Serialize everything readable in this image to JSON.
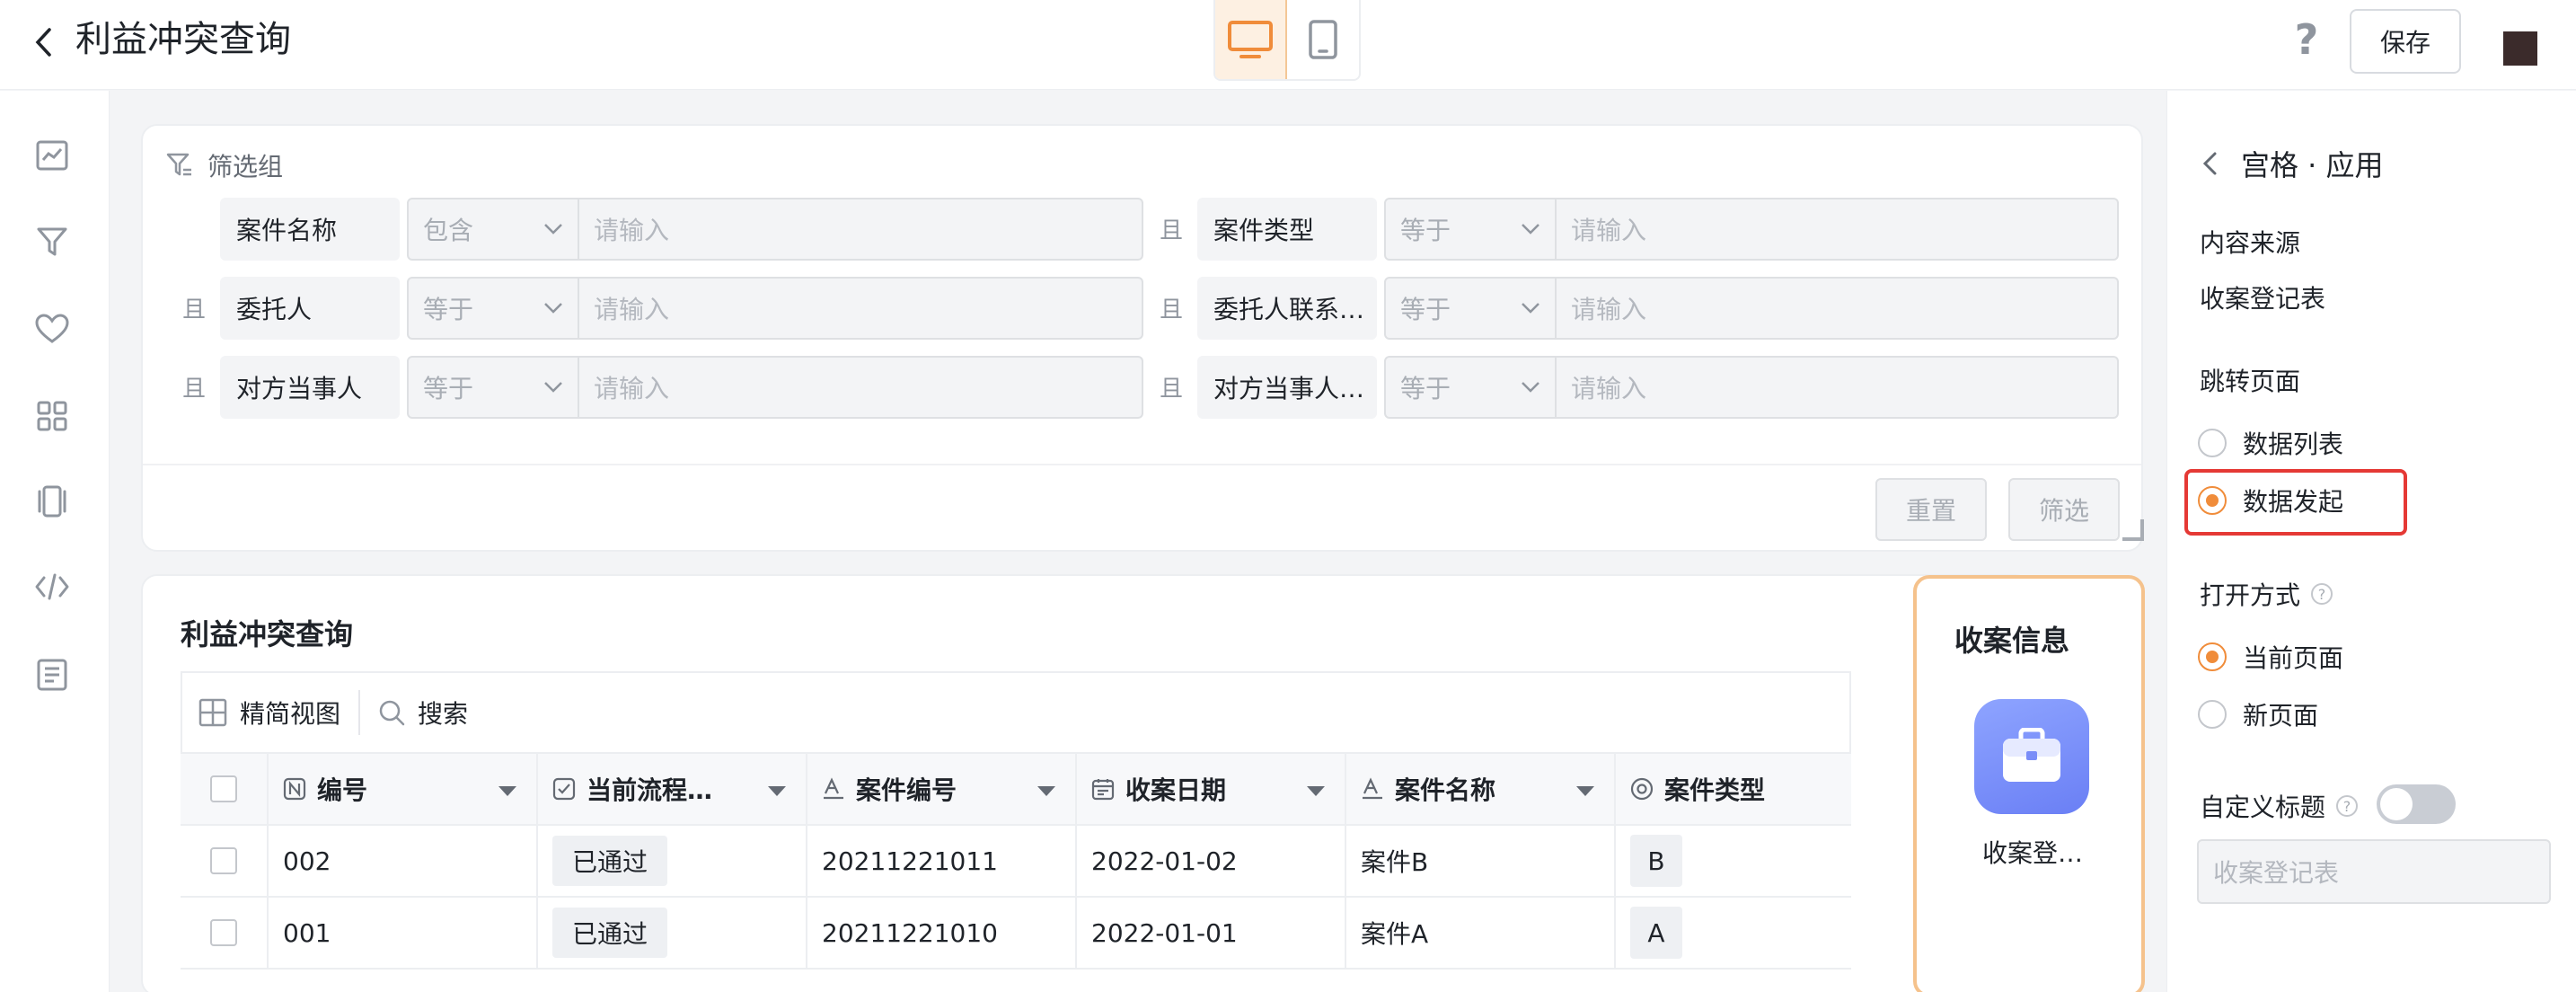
{
  "header": {
    "title": "利益冲突查询",
    "save_label": "保存",
    "help_label": "?"
  },
  "filter": {
    "group_title": "筛选组",
    "and_label": "且",
    "rows": [
      {
        "label": "案件名称",
        "op": "包含",
        "placeholder": "请输入"
      },
      {
        "label": "案件类型",
        "op": "等于",
        "placeholder": "请输入"
      },
      {
        "label": "委托人",
        "op": "等于",
        "placeholder": "请输入"
      },
      {
        "label": "委托人联系…",
        "op": "等于",
        "placeholder": "请输入"
      },
      {
        "label": "对方当事人",
        "op": "等于",
        "placeholder": "请输入"
      },
      {
        "label": "对方当事人…",
        "op": "等于",
        "placeholder": "请输入"
      }
    ],
    "reset_label": "重置",
    "filter_label": "筛选"
  },
  "table": {
    "title": "利益冲突查询",
    "compact_view": "精简视图",
    "search": "搜索",
    "columns": [
      "编号",
      "当前流程…",
      "案件编号",
      "收案日期",
      "案件名称",
      "案件类型"
    ],
    "rows": [
      {
        "id": "002",
        "status": "已通过",
        "case_no": "20211221011",
        "date": "2022-01-02",
        "name": "案件B",
        "type": "B"
      },
      {
        "id": "001",
        "status": "已通过",
        "case_no": "20211221010",
        "date": "2022-01-01",
        "name": "案件A",
        "type": "A"
      }
    ]
  },
  "app_card": {
    "title": "收案信息",
    "label": "收案登…"
  },
  "right_panel": {
    "back_title": "宫格 · 应用",
    "content_source_label": "内容来源",
    "content_source_value": "收案登记表",
    "jump_page_label": "跳转页面",
    "jump_options": [
      "数据列表",
      "数据发起"
    ],
    "open_mode_label": "打开方式",
    "open_options": [
      "当前页面",
      "新页面"
    ],
    "custom_title_label": "自定义标题",
    "custom_title_placeholder": "收案登记表"
  },
  "colors": {
    "accent": "#f08c3a",
    "highlight": "#e53935",
    "app_icon": "#7a8df8"
  }
}
